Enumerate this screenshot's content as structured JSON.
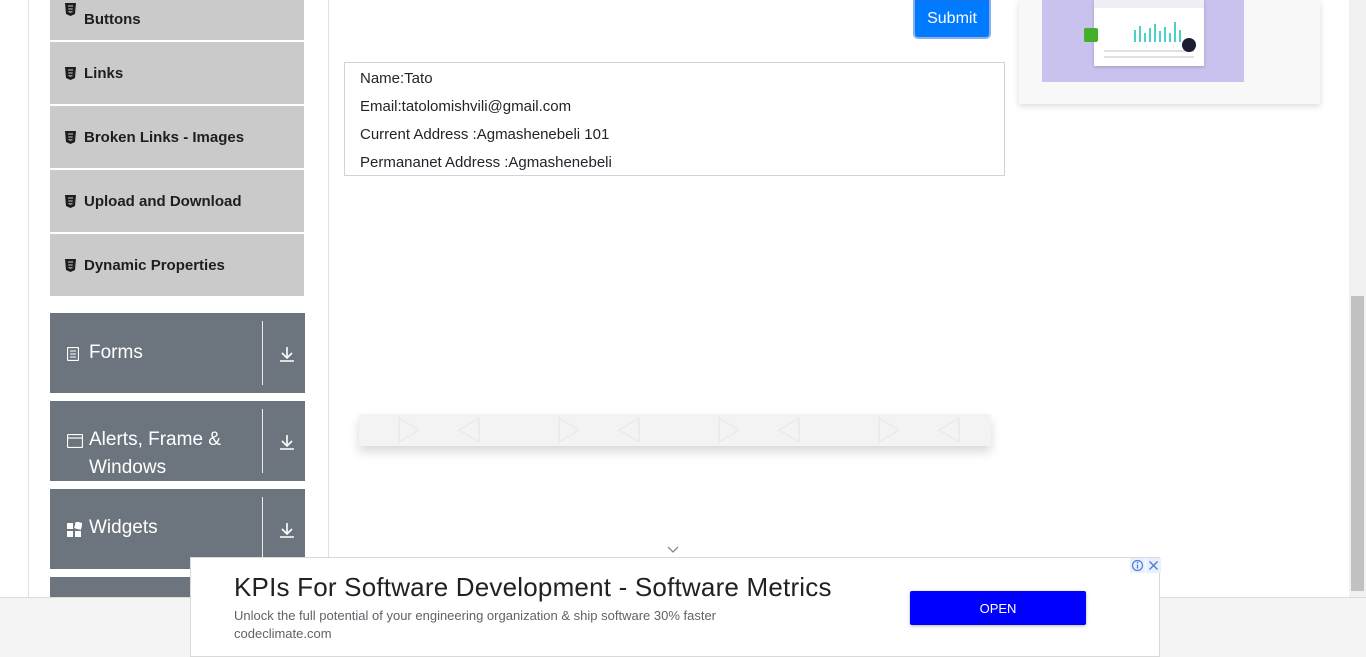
{
  "sidebar": {
    "elements_items": [
      {
        "label": "Buttons"
      },
      {
        "label": "Links"
      },
      {
        "label": "Broken Links - Images"
      },
      {
        "label": "Upload and Download"
      },
      {
        "label": "Dynamic Properties"
      }
    ],
    "groups": [
      {
        "title": "Forms",
        "icon": "document-icon"
      },
      {
        "title": "Alerts, Frame & Windows",
        "icon": "window-icon"
      },
      {
        "title": "Widgets",
        "icon": "widgets-icon"
      }
    ]
  },
  "form": {
    "submit_label": "Submit"
  },
  "output": {
    "name": "Name:Tato",
    "email": "Email:tatolomishvili@gmail.com",
    "current_address": "Current Address :Agmashenebeli 101",
    "permanent_address": "Permananet Address :Agmashenebeli"
  },
  "bottom_ad": {
    "title": "KPIs For Software Development - Software Metrics",
    "description": "Unlock the full potential of your engineering organization & ship software 30% faster",
    "url": "codeclimate.com",
    "cta": "OPEN"
  },
  "colors": {
    "accent": "#007bff",
    "group_bg": "#6c757d",
    "item_bg": "#cacaca",
    "ad_button": "#0000ff"
  }
}
